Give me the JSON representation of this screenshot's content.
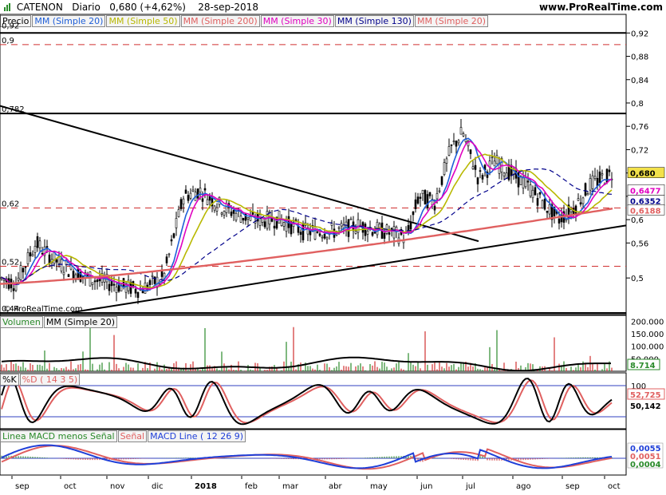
{
  "header": {
    "symbol": "CATENON",
    "period": "Diario",
    "quote": "0,680 (+4,62%)",
    "date": "28-sep-2018",
    "site": "www.ProRealTime.com"
  },
  "price_legend": [
    "Precio",
    "MM (Simple 20)",
    "MM (Simple 50)",
    "MM (Simple 200)",
    "MM (Simple 30)",
    "MM (Simple 130)",
    "MM (Simple 20)"
  ],
  "price_legend_colors": [
    "#000000",
    "#1f5fd8",
    "#b8b800",
    "#e06060",
    "#e000c0",
    "#00008b",
    "#e06060"
  ],
  "price_axis_ticks": [
    "0,92",
    "0,88",
    "0,84",
    "0,8",
    "0,76",
    "0,72",
    "0,68",
    "0,64",
    "0,6",
    "0,56",
    "0,5"
  ],
  "left_labels": [
    "0,92",
    "0,9",
    "0,782",
    "0,62",
    "0,52",
    "0,44"
  ],
  "price_boxes": [
    {
      "text": "0,680",
      "color": "#000000",
      "bg": "#f2e14a"
    },
    {
      "text": "0,6477",
      "color": "#e000c0",
      "bg": "#ffffff"
    },
    {
      "text": "0,6352",
      "color": "#00008b",
      "bg": "#ffffff"
    },
    {
      "text": "0,6188",
      "color": "#e06060",
      "bg": "#ffffff"
    }
  ],
  "copyright": "© ProRealTime.com",
  "volume_legend": [
    "Volumen",
    "MM (Simple 20)"
  ],
  "volume_ticks": [
    "200.000",
    "150.000",
    "100.000",
    "50.000"
  ],
  "volume_box": "8.714",
  "stoch_legend": [
    "%K",
    "%D ( 14 3 5)"
  ],
  "stoch_ticks": [
    "100"
  ],
  "stoch_boxes": [
    "52,725",
    "50,142"
  ],
  "macd_legend": [
    "Linea MACD menos Señal",
    "Señal",
    "MACD Line ( 12 26 9)"
  ],
  "macd_boxes": [
    "0,0055",
    "0,0051",
    "0,0004"
  ],
  "x_axis": [
    "sep",
    "oct",
    "nov",
    "dic",
    "2018",
    "feb",
    "mar",
    "abr",
    "may",
    "jun",
    "jul",
    "ago",
    "sep",
    "oct"
  ],
  "chart_data": {
    "type": "line",
    "title": "CATENON Diario",
    "x": [
      "sep",
      "oct",
      "nov",
      "dic",
      "2018",
      "feb",
      "mar",
      "abr",
      "may",
      "jun",
      "jul",
      "ago",
      "sep"
    ],
    "series": [
      {
        "name": "Precio",
        "values": [
          0.5,
          0.55,
          0.5,
          0.49,
          0.66,
          0.63,
          0.6,
          0.6,
          0.6,
          0.61,
          0.73,
          0.69,
          0.64,
          0.68
        ]
      },
      {
        "name": "MM (Simple 20)",
        "values": [
          0.5,
          0.52,
          0.5,
          0.49,
          0.62,
          0.63,
          0.6,
          0.59,
          0.59,
          0.61,
          0.71,
          0.69,
          0.63,
          0.65
        ]
      },
      {
        "name": "MM (Simple 200)",
        "values": [
          0.49,
          0.49,
          0.49,
          0.5,
          0.52,
          0.54,
          0.55,
          0.56,
          0.57,
          0.58,
          0.59,
          0.6,
          0.61,
          0.619
        ]
      }
    ],
    "ylim": [
      0.44,
      0.93
    ]
  }
}
